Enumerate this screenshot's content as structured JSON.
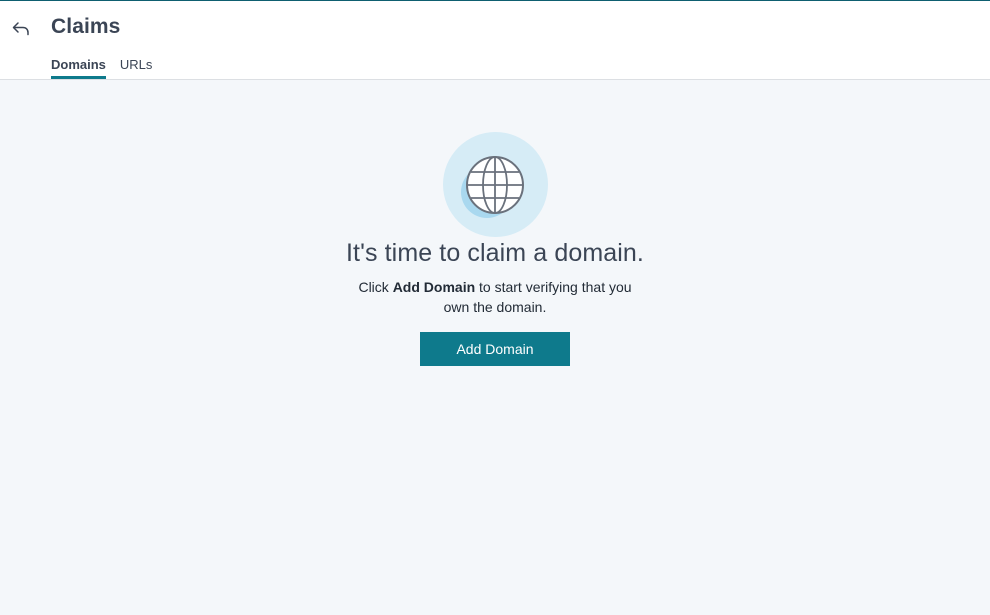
{
  "header": {
    "title": "Claims",
    "back_icon": "back-arrow-icon"
  },
  "tabs": [
    {
      "label": "Domains",
      "active": true
    },
    {
      "label": "URLs",
      "active": false
    }
  ],
  "empty_state": {
    "icon": "globe-icon",
    "headline": "It's time to claim a domain.",
    "desc_prefix": "Click ",
    "desc_bold": "Add Domain",
    "desc_suffix": " to start verifying that you own the domain.",
    "button_label": "Add Domain"
  },
  "colors": {
    "accent": "#0e7a8c",
    "title_text": "#3b4555",
    "background": "#f4f7fa",
    "icon_circle": "#d6ecf6"
  }
}
